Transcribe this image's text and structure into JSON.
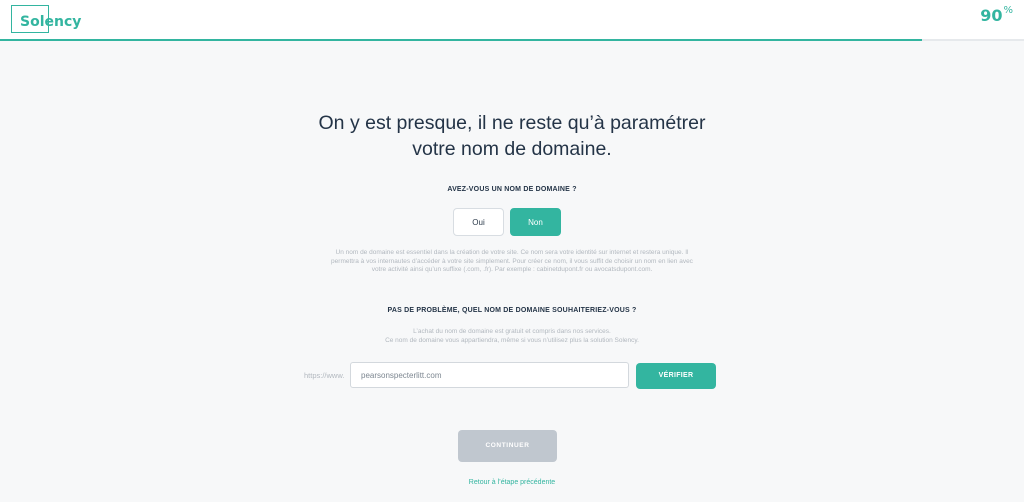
{
  "header": {
    "logo_text": "Solency",
    "progress_value": "90",
    "progress_unit": "%",
    "progress_fraction": 0.9,
    "accent_color": "#33b5a0"
  },
  "main": {
    "headline_line1": "On y est presque, il ne reste qu’à paramétrer",
    "headline_line2": "votre nom de domaine.",
    "question_have_domain": "AVEZ-VOUS UN NOM DE DOMAINE ?",
    "choices": {
      "yes_label": "Oui",
      "no_label": "Non",
      "selected": "Non"
    },
    "domain_help": [
      "Un nom de domaine est essentiel dans la création de votre site. Ce nom sera votre identité sur internet et restera unique. Il",
      "permettra à vos internautes d’accéder à votre site simplement. Pour créer ce nom, il vous suffit de choisir un nom en lien avec",
      "votre activité ainsi qu’un suffixe (.com, .fr). Par exemple : cabinetdupont.fr ou avocatsdupont.com."
    ],
    "question_which_domain": "PAS DE PROBLÈME, QUEL NOM DE DOMAINE SOUHAITERIEZ-VOUS ?",
    "purchase_help": [
      "L’achat du nom de domaine est gratuit et compris dans nos services.",
      "Ce nom de domaine vous appartiendra, même si vous n’utilisez plus la solution Solency."
    ],
    "domain_prefix": "https://www.",
    "domain_value": "pearsonspecterlitt.com",
    "verify_label": "VÉRIFIER",
    "continue_label": "CONTINUER",
    "back_label": "Retour à l’étape précédente"
  }
}
